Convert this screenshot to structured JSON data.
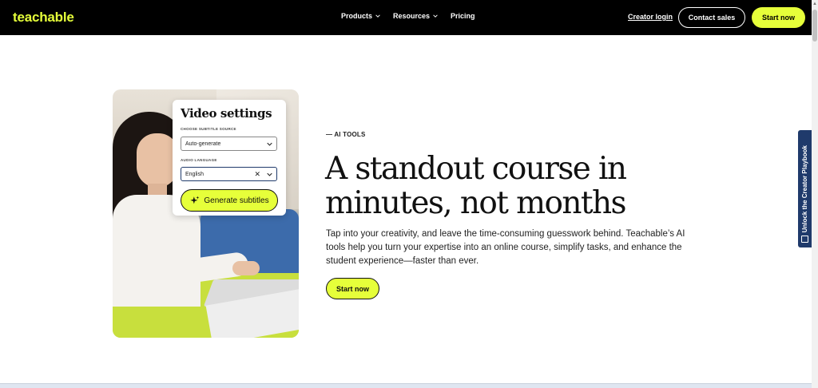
{
  "nav": {
    "logo": "teachable",
    "menu": [
      {
        "label": "Products",
        "dropdown": true
      },
      {
        "label": "Resources",
        "dropdown": true
      },
      {
        "label": "Pricing",
        "dropdown": false
      }
    ],
    "creator_login": "Creator login",
    "contact_sales": "Contact sales",
    "start_now": "Start now"
  },
  "panel": {
    "title": "Video settings",
    "subtitle_source_label": "CHOOSE SUBTITLE SOURCE",
    "subtitle_source_value": "Auto-generate",
    "audio_language_label": "AUDIO LANGUAGE",
    "audio_language_value": "English",
    "generate_button": "Generate subtitles"
  },
  "hero": {
    "eyebrow": "— AI TOOLS",
    "headline": "A standout course in minutes, not months",
    "body": "Tap into your creativity, and leave the time-consuming guesswork behind. Teachable’s AI tools help you turn your expertise into an online course, simplify tasks, and enhance the student experience—faster than ever.",
    "cta": "Start now"
  },
  "side_tab": {
    "label": "Unlock the Creator Playbook"
  },
  "colors": {
    "accent": "#e6ff3a",
    "nav_bg": "#000000",
    "side_tab_bg": "#1f3a6b"
  }
}
